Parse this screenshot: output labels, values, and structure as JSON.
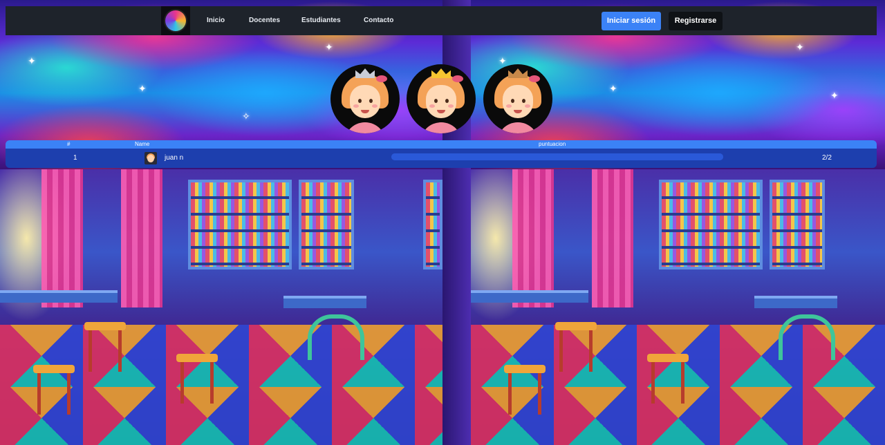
{
  "nav": {
    "links": [
      "Inicio",
      "Docentes",
      "Estudiantes",
      "Contacto"
    ],
    "login_label": "Iniciar sesión",
    "register_label": "Registrarse"
  },
  "leaderboard": {
    "headers": {
      "rank": "#",
      "name": "Name",
      "score": "puntuacion"
    },
    "rows": [
      {
        "rank": "1",
        "name": "juan n",
        "score": "2/2",
        "progress": 1.0
      }
    ]
  },
  "colors": {
    "accent": "#3b82f6",
    "navbar": "#1e232b",
    "row": "#1d3fae"
  }
}
